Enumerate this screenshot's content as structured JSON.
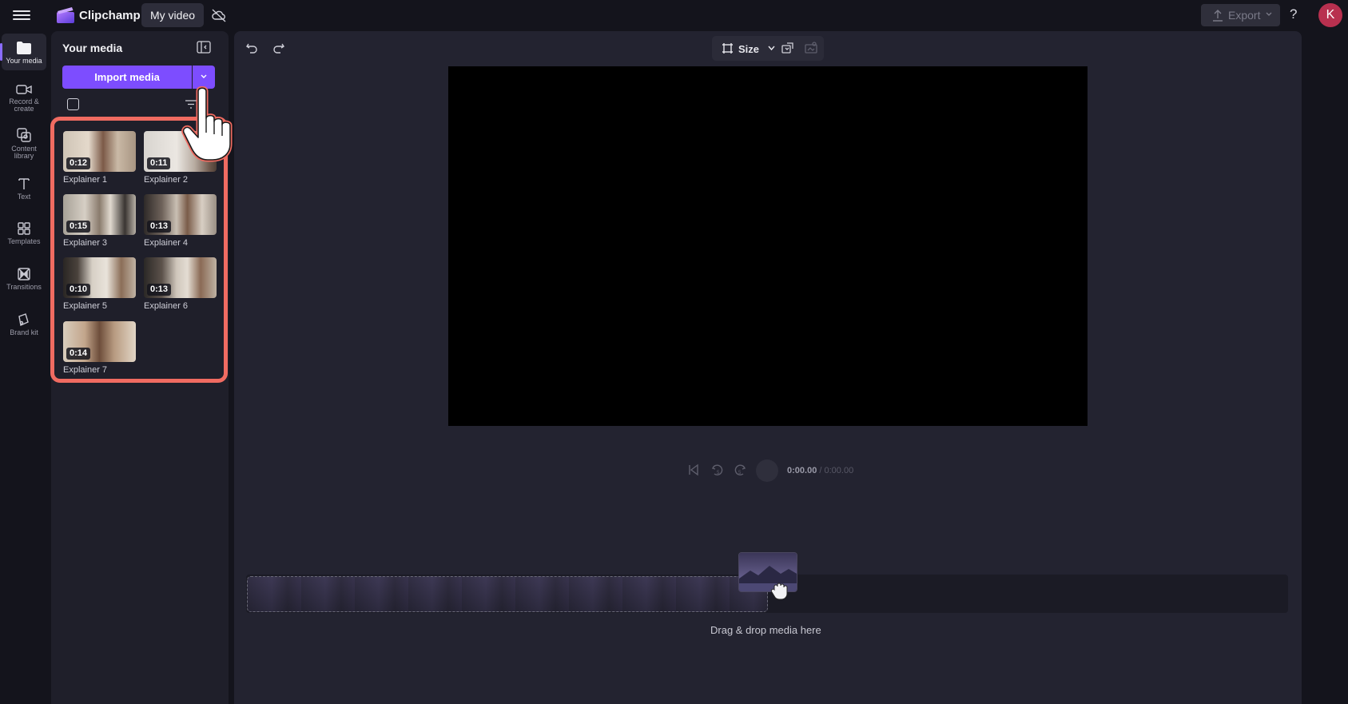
{
  "header": {
    "app_name": "Clipchamp",
    "project_name": "My video",
    "export_label": "Export",
    "help_label": "?",
    "avatar_initial": "K"
  },
  "sidebar": {
    "items": [
      {
        "label": "Your media",
        "icon": "folder-icon",
        "active": true
      },
      {
        "label": "Record & create",
        "icon": "camera-icon",
        "active": false
      },
      {
        "label": "Content library",
        "icon": "library-icon",
        "active": false
      },
      {
        "label": "Text",
        "icon": "text-icon",
        "active": false
      },
      {
        "label": "Templates",
        "icon": "templates-icon",
        "active": false
      },
      {
        "label": "Transitions",
        "icon": "transitions-icon",
        "active": false
      },
      {
        "label": "Brand kit",
        "icon": "brand-kit-icon",
        "active": false
      }
    ]
  },
  "media_panel": {
    "title": "Your media",
    "import_label": "Import media",
    "items": [
      {
        "label": "Explainer 1",
        "duration": "0:12"
      },
      {
        "label": "Explainer 2",
        "duration": "0:11"
      },
      {
        "label": "Explainer 3",
        "duration": "0:15"
      },
      {
        "label": "Explainer 4",
        "duration": "0:13"
      },
      {
        "label": "Explainer 5",
        "duration": "0:10"
      },
      {
        "label": "Explainer 6",
        "duration": "0:13"
      },
      {
        "label": "Explainer 7",
        "duration": "0:14"
      }
    ]
  },
  "toolbar": {
    "size_label": "Size"
  },
  "playback": {
    "current_time": "0:00.00",
    "separator": " / ",
    "total_time": "0:00.00"
  },
  "timeline": {
    "drop_hint": "Drag & drop media here"
  },
  "colors": {
    "accent": "#7d4dff",
    "highlight": "#f06b61",
    "avatar": "#b8304f"
  }
}
